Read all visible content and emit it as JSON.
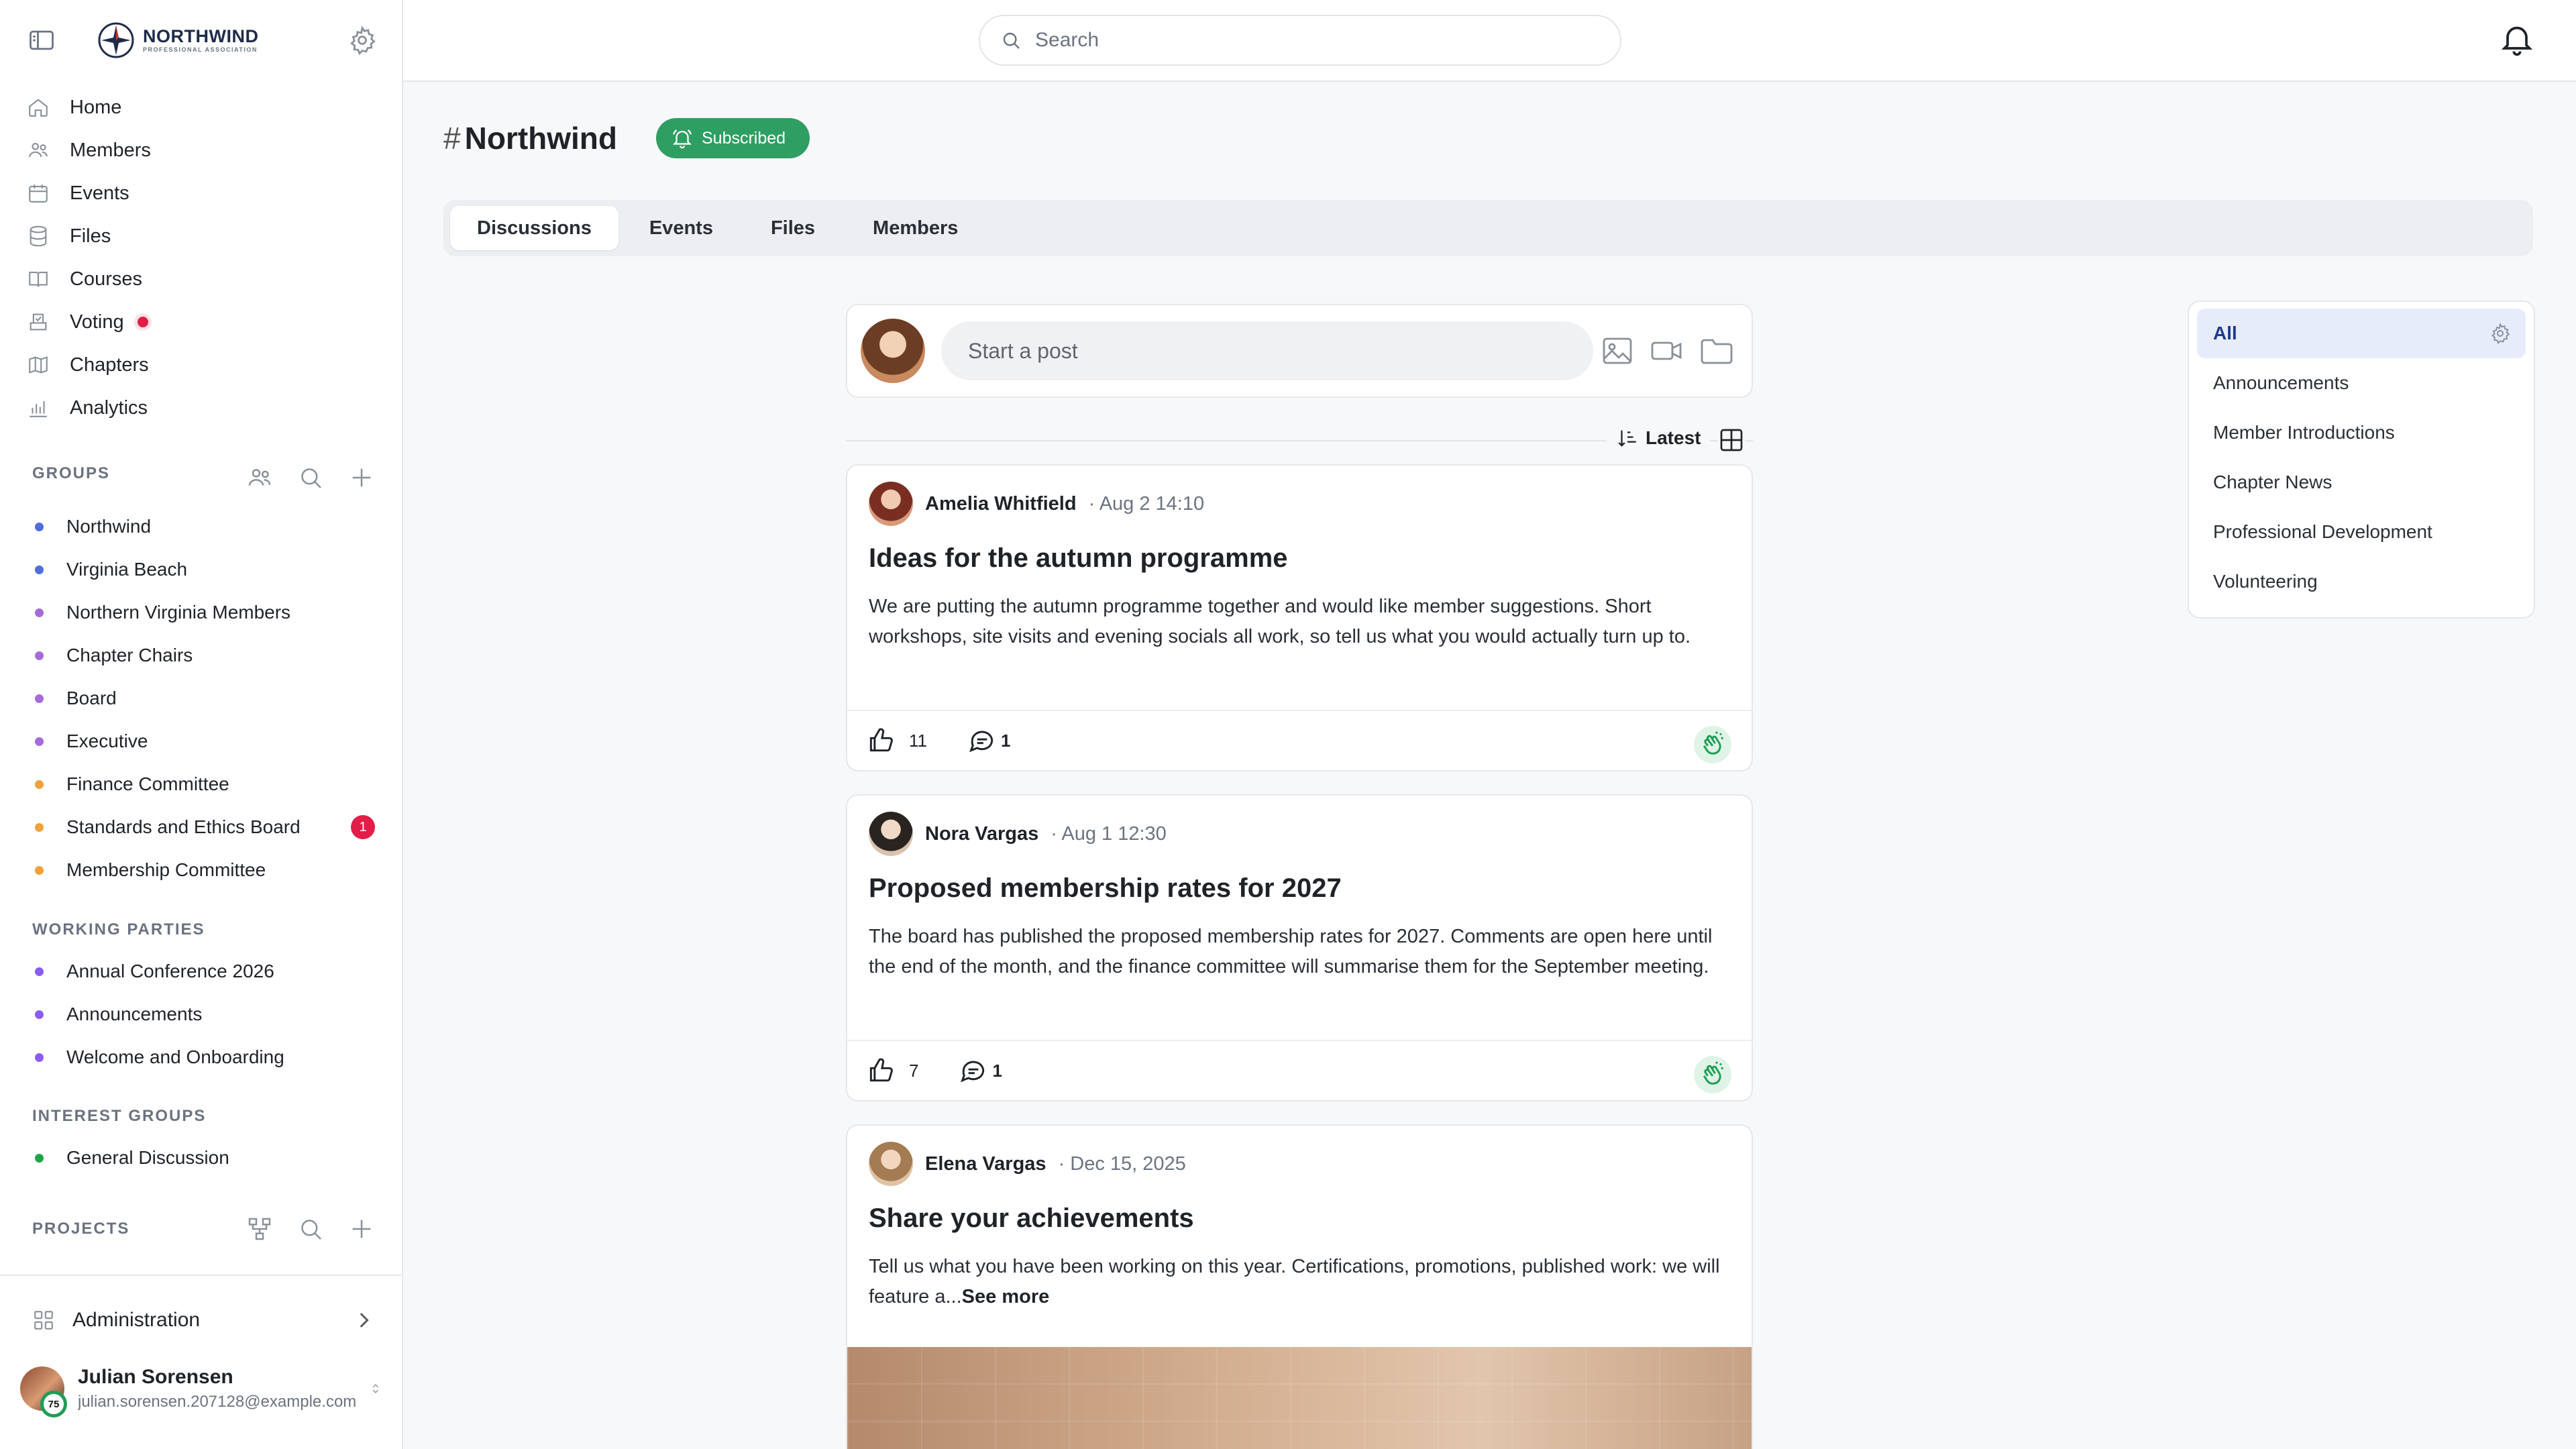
{
  "app": {
    "logo_name": "NORTHWIND",
    "logo_sub": "PROFESSIONAL ASSOCIATION"
  },
  "search": {
    "placeholder": "Search"
  },
  "nav": [
    {
      "label": "Home",
      "icon": "home-icon"
    },
    {
      "label": "Members",
      "icon": "members-icon"
    },
    {
      "label": "Events",
      "icon": "calendar-icon"
    },
    {
      "label": "Files",
      "icon": "database-icon"
    },
    {
      "label": "Courses",
      "icon": "book-icon"
    },
    {
      "label": "Voting",
      "icon": "ballot-icon",
      "alert": true
    },
    {
      "label": "Chapters",
      "icon": "map-icon"
    },
    {
      "label": "Analytics",
      "icon": "chart-icon"
    }
  ],
  "groups": {
    "title": "GROUPS",
    "items": [
      {
        "label": "Northwind",
        "color": "#4f6ddb"
      },
      {
        "label": "Virginia Beach",
        "color": "#4f6ddb"
      },
      {
        "label": "Northern Virginia Members",
        "color": "#a56bd8"
      },
      {
        "label": "Chapter Chairs",
        "color": "#a56bd8"
      },
      {
        "label": "Board",
        "color": "#a56bd8"
      },
      {
        "label": "Executive",
        "color": "#a56bd8"
      },
      {
        "label": "Finance Committee",
        "color": "#f0a23b"
      },
      {
        "label": "Standards and Ethics Board",
        "color": "#f0a23b",
        "badge": "1"
      },
      {
        "label": "Membership Committee",
        "color": "#f0a23b"
      }
    ]
  },
  "working_parties": {
    "title": "WORKING PARTIES",
    "items": [
      {
        "label": "Annual Conference 2026",
        "color": "#8b5cf6"
      },
      {
        "label": "Announcements",
        "color": "#8b5cf6"
      },
      {
        "label": "Welcome and Onboarding",
        "color": "#8b5cf6"
      }
    ]
  },
  "interest_groups": {
    "title": "INTEREST GROUPS",
    "items": [
      {
        "label": "General Discussion",
        "color": "#22a34a"
      }
    ]
  },
  "projects": {
    "title": "PROJECTS"
  },
  "admin": {
    "label": "Administration"
  },
  "user": {
    "name": "Julian Sorensen",
    "email": "julian.sorensen.207128@example.com",
    "score": "75"
  },
  "channel": {
    "title": "Northwind",
    "badge": "Subscribed"
  },
  "tabs": [
    "Discussions",
    "Events",
    "Files",
    "Members"
  ],
  "composer": {
    "placeholder": "Start a post"
  },
  "sort": {
    "label": "Latest"
  },
  "posts": [
    {
      "author": "Amelia Whitfield",
      "time": "Aug 2 14:10",
      "title": "Ideas for the autumn programme",
      "body": "We are putting the autumn programme together and would like member suggestions. Short workshops, site visits and evening socials all work, so tell us what you would actually turn up to.",
      "likes": "11",
      "comments": "1"
    },
    {
      "author": "Nora Vargas",
      "time": "Aug 1 12:30",
      "title": "Proposed membership rates for 2027",
      "body": "The board has published the proposed membership rates for 2027. Comments are open here until the end of the month, and the finance committee will summarise them for the September meeting.",
      "likes": "7",
      "comments": "1"
    },
    {
      "author": "Elena Vargas",
      "time": "Dec 15, 2025",
      "title": "Share your achievements",
      "body": "Tell us what you have been working on this year. Certifications, promotions, published work: we will feature a...",
      "more": "See more"
    }
  ],
  "categories": [
    "All",
    "Announcements",
    "Member Introductions",
    "Chapter News",
    "Professional Development",
    "Volunteering"
  ]
}
